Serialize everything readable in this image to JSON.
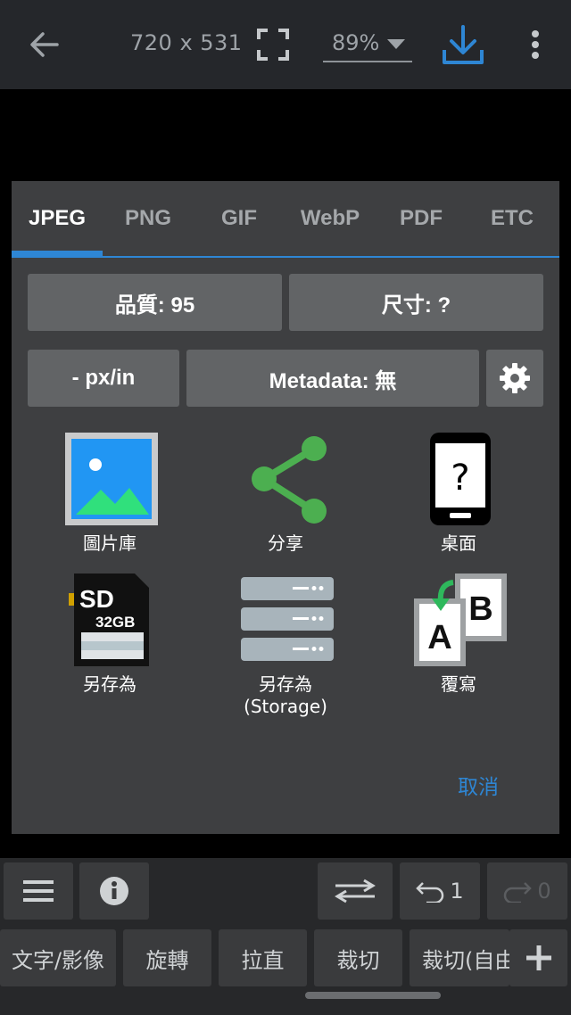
{
  "topbar": {
    "back_icon": "arrow-left-icon",
    "dimensions": "720 x 531",
    "fullscreen_icon": "fullscreen-icon",
    "zoom": "89%",
    "download_icon": "download-icon",
    "more_icon": "more-vert-icon",
    "accent_color": "#2e86d4"
  },
  "dialog": {
    "tabs": [
      {
        "label": "JPEG",
        "active": true
      },
      {
        "label": "PNG",
        "active": false
      },
      {
        "label": "GIF",
        "active": false
      },
      {
        "label": "WebP",
        "active": false
      },
      {
        "label": "PDF",
        "active": false
      },
      {
        "label": "ETC",
        "active": false
      }
    ],
    "quality_label": "品質: 95",
    "size_label": "尺寸: ?",
    "dpi_label": "- px/in",
    "metadata_label": "Metadata: 無",
    "settings_icon": "gear-icon",
    "actions": [
      {
        "label": "圖片庫",
        "icon": "gallery-icon"
      },
      {
        "label": "分享",
        "icon": "share-icon"
      },
      {
        "label": "桌面",
        "icon": "phone-question-icon"
      },
      {
        "label": "另存為",
        "icon": "sd-card-icon",
        "card_text": "SD",
        "card_capacity": "32GB"
      },
      {
        "label": "另存為",
        "label2": "(Storage)",
        "icon": "storage-server-icon"
      },
      {
        "label": "覆寫",
        "icon": "overwrite-ab-icon",
        "letter_a": "A",
        "letter_b": "B"
      }
    ],
    "cancel_label": "取消"
  },
  "toolbar": {
    "menu_icon": "menu-icon",
    "info_icon": "info-icon",
    "swap_icon": "swap-arrows-icon",
    "undo_count": "1",
    "redo_count": "0",
    "tools": [
      "文字/影像",
      "旋轉",
      "拉直",
      "裁切",
      "裁切(自由"
    ],
    "add_icon": "plus-icon"
  }
}
